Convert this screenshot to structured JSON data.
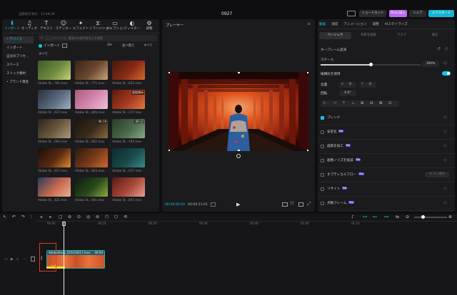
{
  "titlebar": {
    "autosave": "自動保存済み：13:48:38",
    "project_name": "0927",
    "shortcut_label": "ショートカット",
    "join_pro_label": "Proに加入",
    "share_label": "シェア",
    "export_label": "エクスポート"
  },
  "toolbar": {
    "items": [
      {
        "label": "インポート",
        "icon": "import-icon"
      },
      {
        "label": "オーディオ",
        "icon": "audio-icon"
      },
      {
        "label": "テキスト",
        "icon": "text-icon"
      },
      {
        "label": "ステッカー",
        "icon": "sticker-icon"
      },
      {
        "label": "エフェクト",
        "icon": "effect-icon"
      },
      {
        "label": "トランジション",
        "icon": "transition-icon"
      },
      {
        "label": "キャプション",
        "icon": "caption-icon"
      },
      {
        "label": "フィルター",
        "icon": "filter-icon"
      },
      {
        "label": "調整",
        "icon": "adjust-icon"
      }
    ]
  },
  "media_sidebar": {
    "items": [
      "• デバイス",
      "インポート",
      "自分のプリセ…",
      "スペース",
      "ストック素材",
      "• ブランド資産"
    ]
  },
  "media": {
    "search_placeholder": "ここでファイル、動画内の被写体などを検索",
    "import_toggle": "インポート",
    "sort_label": "並べ替え",
    "filter_label": "すべて",
    "section_label": "すべて",
    "thumbs": [
      {
        "caption": "Adobe St…781.mov",
        "duration": "",
        "colors": [
          "#3a5a2a",
          "#6f8a3f",
          "#c8d27a"
        ]
      },
      {
        "caption": "Adobe St…771.mov",
        "duration": "",
        "colors": [
          "#3a2318",
          "#6b4a30",
          "#caa37a"
        ]
      },
      {
        "caption": "Adobe St…833.mov",
        "duration": "",
        "colors": [
          "#401a10",
          "#8a2a15",
          "#d46a2a"
        ]
      },
      {
        "caption": "Adobe St…427.mov",
        "duration": "",
        "colors": [
          "#2a2e3a",
          "#5a6a7e",
          "#9fb0c0"
        ]
      },
      {
        "caption": "Adobe St…846.mov",
        "duration": "",
        "colors": [
          "#a85a7a",
          "#d48ab0",
          "#f0c0d8"
        ]
      },
      {
        "caption": "Adobe St…217.mov",
        "duration": "追加済み",
        "colors": [
          "#5a1a10",
          "#a83a20",
          "#e07a40"
        ]
      },
      {
        "caption": "Adobe St…083.mov",
        "duration": "",
        "colors": [
          "#2a2418",
          "#6b5a40",
          "#b09a78"
        ]
      },
      {
        "caption": "Adobe St…842.mov",
        "duration": "00:19",
        "colors": [
          "#1a1410",
          "#3a2a1a",
          "#8a6a40"
        ]
      },
      {
        "caption": "Adobe St…193.mov",
        "duration": "00:12",
        "colors": [
          "#2a3a2a",
          "#4a6a4a",
          "#8aaa8a"
        ]
      },
      {
        "caption": "Adobe St…427.mov",
        "duration": "",
        "colors": [
          "#1a0c08",
          "#5a2a10",
          "#e08a30"
        ]
      },
      {
        "caption": "Adobe St…843.mov",
        "duration": "",
        "colors": [
          "#2a1a10",
          "#7a3a1a",
          "#d06a30"
        ]
      },
      {
        "caption": "Adobe St…037.mov",
        "duration": "",
        "colors": [
          "#0e2a2a",
          "#1a4a4a",
          "#3a8a8a"
        ]
      },
      {
        "caption": "Adobe St…421.mov",
        "duration": "",
        "colors": [
          "#2a3a5a",
          "#c86a50",
          "#e8b090"
        ]
      },
      {
        "caption": "Adobe St…841.mov",
        "duration": "",
        "colors": [
          "#0e1a10",
          "#2a4a1a",
          "#8aaa40"
        ]
      },
      {
        "caption": "Adobe St…847.mov",
        "duration": "",
        "colors": [
          "#5a1a18",
          "#a84a3a",
          "#e8a090"
        ]
      }
    ]
  },
  "player": {
    "title": "プレーヤー",
    "time_current": "00:00:00:00",
    "time_total": "00:00:11:01"
  },
  "properties": {
    "tabs": [
      "動画",
      "速度",
      "アニメーション",
      "調整",
      "AIスタイライズ"
    ],
    "subtabs": [
      "ベーシック",
      "背景を削除",
      "マスク",
      "補正"
    ],
    "section_keyframe": "キーフレーム変身",
    "scale_label": "スケール",
    "scale_value": "100%",
    "scale_fraction": 0.5,
    "uniform_label": "縦横比を保持",
    "position_label": "位置",
    "pos_x": "0",
    "pos_y": "0",
    "rotation_label": "回転",
    "rotation_value": "0.0°",
    "options": [
      {
        "label": "ブレンド",
        "pro": false
      },
      {
        "label": "安定化",
        "pro": true
      },
      {
        "label": "画質を加工",
        "pro": true
      },
      {
        "label": "画像ノイズを低減",
        "pro": true
      },
      {
        "label": "オプティカルフロー",
        "pro": true
      },
      {
        "label": "リサイト",
        "pro": true
      },
      {
        "label": "点数フレーム",
        "pro": true
      }
    ],
    "optical_btn": "オフに保存",
    "pro_label": "Pro"
  },
  "timeline": {
    "ticks": [
      "00:00",
      "00:10",
      "00:20",
      "00:30",
      "00:40",
      "01:00",
      "01:10"
    ],
    "clip_label": "AdobeStock_555416217.mov",
    "clip_time": "00:00",
    "colors": {
      "clip": "#2ba6a8",
      "accent": "#16c5e6",
      "highlight": "#e8352b"
    }
  }
}
